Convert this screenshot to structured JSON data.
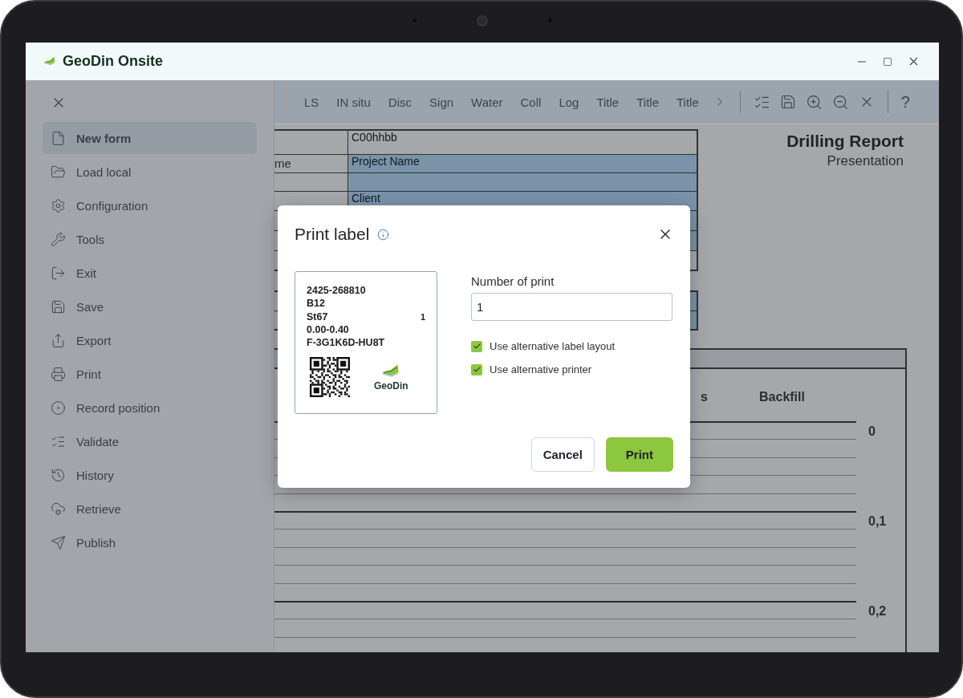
{
  "app": {
    "title": "GeoDin Onsite"
  },
  "sidebar": {
    "items": [
      {
        "label": "New form",
        "selected": true
      },
      {
        "label": "Load local",
        "selected": false
      },
      {
        "label": "Configuration",
        "selected": false
      },
      {
        "label": "Tools",
        "selected": false
      },
      {
        "label": "Exit",
        "selected": false
      },
      {
        "label": "Save",
        "selected": false
      },
      {
        "label": "Export",
        "selected": false
      },
      {
        "label": "Print",
        "selected": false
      },
      {
        "label": "Record position",
        "selected": false
      },
      {
        "label": "Validate",
        "selected": false
      },
      {
        "label": "History",
        "selected": false
      },
      {
        "label": "Retrieve",
        "selected": false
      },
      {
        "label": "Publish",
        "selected": false
      }
    ]
  },
  "toolbar": {
    "tabs": [
      "LS",
      "IN situ",
      "Disc",
      "Sign",
      "Water",
      "Coll",
      "Log",
      "Title",
      "Title",
      "Title"
    ],
    "help_label": "?"
  },
  "document": {
    "title": "Drilling Report",
    "subtitle": "Presentation",
    "header_rows": [
      {
        "value": "C00hhbb",
        "highlighted": false
      },
      {
        "label": "me",
        "value": "Project Name",
        "highlighted": true
      },
      {
        "highlighted": true
      },
      {
        "value": "Client",
        "highlighted": true
      },
      {
        "highlighted": true
      },
      {
        "highlighted": true
      },
      {
        "highlighted": false
      }
    ],
    "extra_rows": [
      {
        "highlighted": true
      },
      {
        "highlighted": true
      }
    ],
    "columns": [
      "s",
      "Backfill"
    ],
    "depth_ticks": [
      "0",
      "0,1",
      "0,2"
    ]
  },
  "dialog": {
    "title": "Print label",
    "label_preview": {
      "lines": [
        "2425-268810",
        "B12",
        "St67",
        "0.00-0.40",
        "F-3G1K6D-HU8T"
      ],
      "count": "1",
      "logo_text": "GeoDin"
    },
    "field": {
      "label": "Number of print",
      "value": "1"
    },
    "options": [
      {
        "label": "Use alternative label layout",
        "checked": true
      },
      {
        "label": "Use alternative printer",
        "checked": true
      }
    ],
    "buttons": [
      {
        "label": "Cancel",
        "kind": "secondary"
      },
      {
        "label": "Print",
        "kind": "primary"
      }
    ]
  }
}
